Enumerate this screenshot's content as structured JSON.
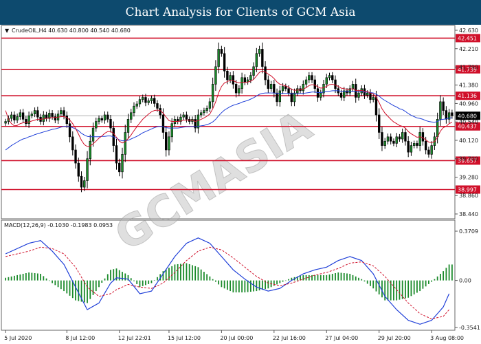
{
  "banner_title": "Chart Analysis for Clients of GCM Asia",
  "watermark_text": "GCMASIA",
  "chart_data": {
    "type": "candlestick",
    "symbol_header": "CrudeOIL,H4  40.630 40.800 40.540 40.680",
    "current_price": 40.68,
    "current_price_label": "40.680",
    "price_ylim": [
      38.44,
      42.63
    ],
    "price_ticks": [
      "42.630",
      "42.210",
      "41.790",
      "41.380",
      "40.960",
      "40.540",
      "40.120",
      "39.700",
      "39.280",
      "38.860",
      "38.440"
    ],
    "levels": [
      {
        "label": "42.451",
        "value": 42.451
      },
      {
        "label": "41.739",
        "value": 41.739
      },
      {
        "label": "41.136",
        "value": 41.136
      },
      {
        "label": "40.437",
        "value": 40.437
      },
      {
        "label": "39.657",
        "value": 39.657
      },
      {
        "label": "38.997",
        "value": 38.997
      }
    ],
    "x_ticks": [
      {
        "label": "5 Jul 2020",
        "i": 0
      },
      {
        "label": "8 Jul 12:00",
        "i": 21
      },
      {
        "label": "12 Jul 22:01",
        "i": 39
      },
      {
        "label": "15 Jul 12:00",
        "i": 56
      },
      {
        "label": "20 Jul 00:00",
        "i": 74
      },
      {
        "label": "22 Jul 16:00",
        "i": 92
      },
      {
        "label": "27 Jul 04:00",
        "i": 110
      },
      {
        "label": "29 Jul 20:00",
        "i": 128
      },
      {
        "label": "3 Aug 08:00",
        "i": 146
      }
    ],
    "close": [
      40.55,
      40.62,
      40.7,
      40.58,
      40.66,
      40.75,
      40.6,
      40.5,
      40.68,
      40.72,
      40.8,
      40.65,
      40.55,
      40.7,
      40.62,
      40.74,
      40.66,
      40.58,
      40.72,
      40.8,
      40.68,
      40.5,
      40.2,
      39.9,
      39.6,
      39.3,
      39.05,
      39.2,
      39.7,
      40.1,
      40.4,
      40.55,
      40.62,
      40.58,
      40.7,
      40.6,
      40.4,
      40.0,
      39.6,
      39.4,
      39.8,
      40.3,
      40.6,
      40.75,
      40.9,
      40.95,
      41.05,
      41.1,
      40.98,
      41.02,
      41.08,
      40.96,
      40.85,
      40.7,
      40.3,
      39.9,
      40.2,
      40.5,
      40.6,
      40.55,
      40.65,
      40.7,
      40.6,
      40.55,
      40.6,
      40.4,
      40.7,
      40.75,
      40.8,
      40.85,
      41.0,
      41.4,
      41.8,
      42.2,
      42.1,
      41.7,
      41.5,
      41.6,
      41.4,
      41.2,
      41.3,
      41.55,
      41.45,
      41.5,
      41.6,
      41.8,
      42.1,
      42.2,
      41.8,
      41.5,
      41.3,
      41.4,
      41.2,
      41.0,
      41.25,
      41.35,
      41.3,
      41.2,
      41.0,
      41.2,
      41.3,
      41.25,
      41.4,
      41.5,
      41.6,
      41.5,
      41.3,
      41.1,
      41.2,
      41.4,
      41.55,
      41.6,
      41.5,
      41.3,
      41.2,
      41.1,
      41.25,
      41.2,
      41.3,
      41.4,
      41.1,
      41.2,
      41.3,
      41.15,
      41.2,
      41.05,
      41.1,
      40.7,
      40.3,
      40.0,
      40.1,
      40.2,
      40.1,
      40.05,
      40.2,
      40.15,
      40.3,
      40.1,
      39.85,
      40.0,
      40.05,
      40.0,
      40.3,
      40.1,
      39.9,
      39.8,
      40.0,
      40.2,
      40.6,
      41.0,
      40.8,
      40.6,
      40.75,
      40.68
    ],
    "ma_red": [
      40.8,
      40.6,
      40.5,
      40.45,
      40.46,
      40.5,
      40.52,
      40.53,
      40.54,
      40.56,
      40.58,
      40.6,
      40.6,
      40.61,
      40.62,
      40.63,
      40.64,
      40.64,
      40.65,
      40.66,
      40.66,
      40.64,
      40.58,
      40.5,
      40.39,
      40.26,
      40.12,
      40.02,
      39.98,
      39.99,
      40.04,
      40.1,
      40.17,
      40.22,
      40.28,
      40.32,
      40.32,
      40.28,
      40.19,
      40.1,
      40.06,
      40.09,
      40.16,
      40.24,
      40.34,
      40.43,
      40.52,
      40.6,
      40.66,
      40.72,
      40.77,
      40.8,
      40.81,
      40.8,
      40.74,
      40.65,
      40.57,
      40.55,
      40.55,
      40.55,
      40.56,
      40.58,
      40.58,
      40.58,
      40.58,
      40.55,
      40.57,
      40.6,
      40.63,
      40.67,
      40.72,
      40.84,
      41.0,
      41.2,
      41.35,
      41.43,
      41.46,
      41.49,
      41.48,
      41.45,
      41.43,
      41.44,
      41.44,
      41.45,
      41.47,
      41.51,
      41.59,
      41.67,
      41.7,
      41.68,
      41.63,
      41.59,
      41.53,
      41.45,
      41.4,
      41.38,
      41.36,
      41.33,
      41.28,
      41.26,
      41.27,
      41.27,
      41.29,
      41.32,
      41.37,
      41.39,
      41.38,
      41.34,
      41.31,
      41.32,
      41.35,
      41.39,
      41.4,
      41.38,
      41.35,
      41.31,
      41.3,
      41.28,
      41.28,
      41.3,
      41.26,
      41.25,
      41.26,
      41.24,
      41.23,
      41.2,
      41.18,
      41.1,
      40.98,
      40.84,
      40.74,
      40.67,
      40.6,
      40.54,
      40.5,
      40.46,
      40.44,
      40.4,
      40.32,
      40.27,
      40.23,
      40.19,
      40.2,
      40.18,
      40.13,
      40.08,
      40.07,
      40.09,
      40.19,
      40.33,
      40.41,
      40.44,
      40.5,
      40.53
    ],
    "ma_blue": [
      39.9,
      39.95,
      40.0,
      40.04,
      40.08,
      40.12,
      40.15,
      40.17,
      40.2,
      40.22,
      40.25,
      40.27,
      40.29,
      40.31,
      40.33,
      40.35,
      40.37,
      40.38,
      40.4,
      40.42,
      40.44,
      40.44,
      40.43,
      40.41,
      40.38,
      40.34,
      40.28,
      40.24,
      40.21,
      40.2,
      40.2,
      40.2,
      40.2,
      40.21,
      40.21,
      40.22,
      40.22,
      40.2,
      40.17,
      40.13,
      40.11,
      40.11,
      40.12,
      40.15,
      40.18,
      40.21,
      40.25,
      40.29,
      40.32,
      40.35,
      40.38,
      40.41,
      40.43,
      40.44,
      40.43,
      40.41,
      40.4,
      40.4,
      40.4,
      40.4,
      40.41,
      40.42,
      40.43,
      40.43,
      40.44,
      40.43,
      40.44,
      40.45,
      40.46,
      40.48,
      40.5,
      40.54,
      40.6,
      40.68,
      40.75,
      40.81,
      40.85,
      40.89,
      40.92,
      40.94,
      40.96,
      40.99,
      41.01,
      41.03,
      41.06,
      41.09,
      41.13,
      41.17,
      41.19,
      41.2,
      41.2,
      41.2,
      41.2,
      41.19,
      41.19,
      41.19,
      41.19,
      41.19,
      41.18,
      41.18,
      41.18,
      41.19,
      41.19,
      41.2,
      41.21,
      41.22,
      41.22,
      41.21,
      41.21,
      41.22,
      41.23,
      41.24,
      41.25,
      41.25,
      41.25,
      41.24,
      41.24,
      41.24,
      41.24,
      41.24,
      41.23,
      41.23,
      41.23,
      41.22,
      41.22,
      41.21,
      41.2,
      41.17,
      41.13,
      41.07,
      41.03,
      40.99,
      40.95,
      40.91,
      40.88,
      40.84,
      40.82,
      40.78,
      40.73,
      40.69,
      40.66,
      40.63,
      40.62,
      40.6,
      40.57,
      40.55,
      40.54,
      40.53,
      40.55,
      40.59,
      40.6,
      40.61,
      40.63,
      40.63
    ],
    "macd": {
      "header": "MACD(12,26,9) -0.1030 -0.1983 0.0953",
      "ylim": [
        -0.3541,
        0.3709
      ],
      "ticks": [
        "0.3709",
        "0.00",
        "-0.3541"
      ],
      "macd_points": [
        [
          0,
          0.2
        ],
        [
          8,
          0.28
        ],
        [
          12,
          0.3
        ],
        [
          16,
          0.22
        ],
        [
          20,
          0.12
        ],
        [
          24,
          -0.05
        ],
        [
          28,
          -0.22
        ],
        [
          32,
          -0.17
        ],
        [
          36,
          -0.02
        ],
        [
          38,
          0.02
        ],
        [
          42,
          0.01
        ],
        [
          46,
          -0.1
        ],
        [
          50,
          -0.08
        ],
        [
          54,
          0.05
        ],
        [
          58,
          0.18
        ],
        [
          62,
          0.28
        ],
        [
          66,
          0.32
        ],
        [
          70,
          0.28
        ],
        [
          74,
          0.18
        ],
        [
          78,
          0.08
        ],
        [
          82,
          0.01
        ],
        [
          86,
          -0.05
        ],
        [
          90,
          -0.08
        ],
        [
          94,
          -0.06
        ],
        [
          98,
          0.0
        ],
        [
          102,
          0.05
        ],
        [
          106,
          0.08
        ],
        [
          110,
          0.1
        ],
        [
          114,
          0.15
        ],
        [
          118,
          0.18
        ],
        [
          122,
          0.15
        ],
        [
          126,
          0.05
        ],
        [
          130,
          -0.12
        ],
        [
          134,
          -0.22
        ],
        [
          138,
          -0.3
        ],
        [
          142,
          -0.33
        ],
        [
          146,
          -0.3
        ],
        [
          150,
          -0.2
        ],
        [
          152,
          -0.1
        ]
      ],
      "signal_points": [
        [
          0,
          0.18
        ],
        [
          8,
          0.22
        ],
        [
          12,
          0.25
        ],
        [
          16,
          0.24
        ],
        [
          20,
          0.2
        ],
        [
          24,
          0.1
        ],
        [
          28,
          -0.05
        ],
        [
          32,
          -0.12
        ],
        [
          36,
          -0.1
        ],
        [
          38,
          -0.07
        ],
        [
          42,
          -0.03
        ],
        [
          46,
          -0.05
        ],
        [
          50,
          -0.06
        ],
        [
          54,
          -0.02
        ],
        [
          58,
          0.06
        ],
        [
          62,
          0.15
        ],
        [
          66,
          0.22
        ],
        [
          70,
          0.25
        ],
        [
          74,
          0.23
        ],
        [
          78,
          0.17
        ],
        [
          82,
          0.1
        ],
        [
          86,
          0.03
        ],
        [
          90,
          -0.02
        ],
        [
          94,
          -0.04
        ],
        [
          98,
          -0.02
        ],
        [
          102,
          0.01
        ],
        [
          106,
          0.04
        ],
        [
          110,
          0.06
        ],
        [
          114,
          0.09
        ],
        [
          118,
          0.13
        ],
        [
          122,
          0.14
        ],
        [
          126,
          0.11
        ],
        [
          130,
          0.03
        ],
        [
          134,
          -0.07
        ],
        [
          138,
          -0.17
        ],
        [
          142,
          -0.25
        ],
        [
          146,
          -0.29
        ],
        [
          150,
          -0.27
        ],
        [
          152,
          -0.22
        ]
      ]
    }
  }
}
